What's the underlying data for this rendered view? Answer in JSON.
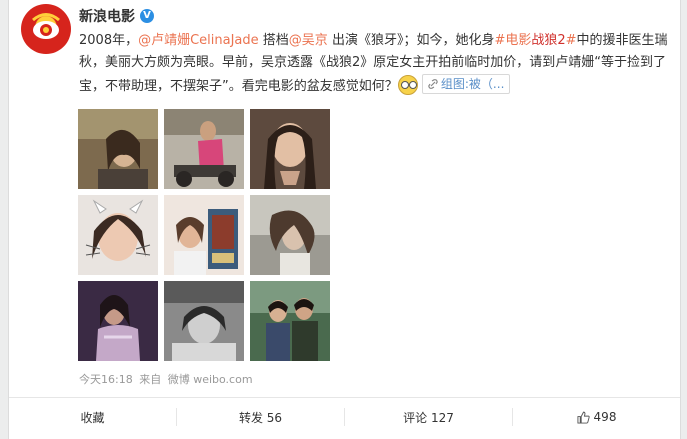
{
  "post": {
    "username": "新浪电影",
    "verified_badge": "V",
    "text": {
      "p1": "2008年，",
      "mention1": "@卢靖姗CelinaJade",
      "p2": " 搭档",
      "mention2": "@吴京",
      "p3": " 出演《狼牙》；如今，她化身",
      "hashtag_a": "#电影",
      "hashtag_b": "战狼2",
      "hashtag_c": "#",
      "p4": "中的援非医生瑞秋，美丽大方颇为亮眼。早前，吴京透露《战狼2》原定女主开拍前临时加价，请到卢靖姗“等于捡到了宝，不带助理，不摆架子”。看完电影的盆友感觉如何？"
    },
    "tag_button": "组图:被（...",
    "photos": [
      {
        "name": "photo-1"
      },
      {
        "name": "photo-2"
      },
      {
        "name": "photo-3"
      },
      {
        "name": "photo-4"
      },
      {
        "name": "photo-5"
      },
      {
        "name": "photo-6"
      },
      {
        "name": "photo-7"
      },
      {
        "name": "photo-8"
      },
      {
        "name": "photo-9"
      }
    ],
    "meta": {
      "time": "今天16:18",
      "from_label": "来自",
      "source": "微博 weibo.com"
    }
  },
  "actions": {
    "favorite": "收藏",
    "repost": "转发 56",
    "comment": "评论 127",
    "like": "498"
  }
}
